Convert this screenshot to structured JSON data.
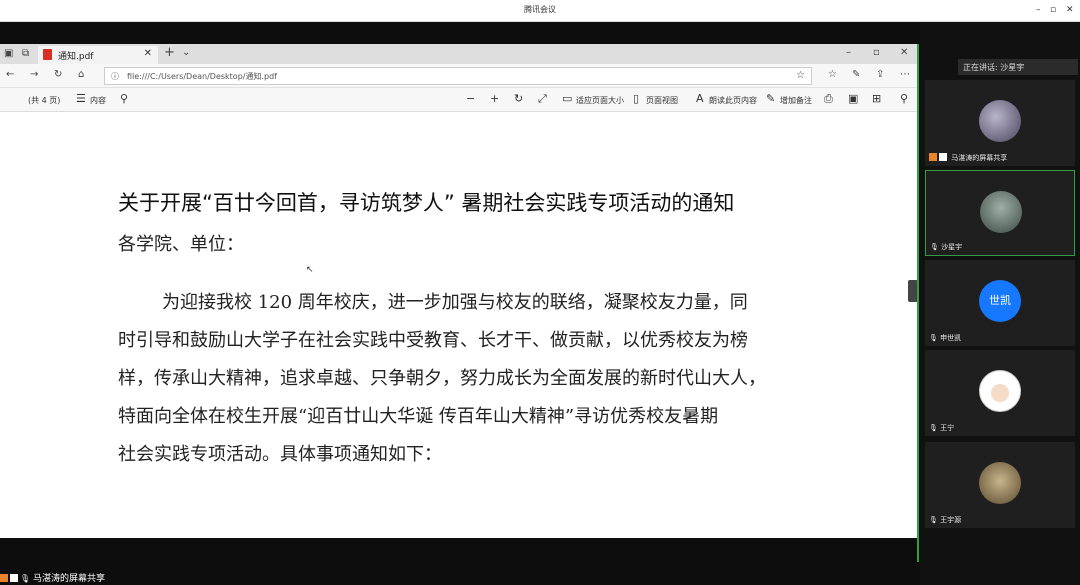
{
  "meeting": {
    "title": "腾讯会议"
  },
  "browser": {
    "tab_title": "通知.pdf",
    "url": "file:///C:/Users/Dean/Desktop/通知.pdf"
  },
  "pdf_toolbar": {
    "page_count": "(共 4 页)",
    "contents": "内容",
    "fit_page": "适应页面大小",
    "page_view": "页面视图",
    "read_aloud": "朗读此页内容",
    "add_note": "增加备注"
  },
  "document": {
    "title": "关于开展“百廿今回首，寻访筑梦人”  暑期社会实践专项活动的通知",
    "salutation": "各学院、单位：",
    "lines": [
      "为迎接我校 120 周年校庆，进一步加强与校友的联络，凝聚校友力量，同",
      "时引导和鼓励山大学子在社会实践中受教育、长才干、做贡献，以优秀校友为榜",
      "样，传承山大精神，追求卓越、只争朝夕，努力成长为全面发展的新时代山大人，",
      "特面向全体在校生开展“迎百廿山大华诞  传百年山大精神”寻访优秀校友暑期",
      "社会实践专项活动。具体事项通知如下："
    ]
  },
  "panel": {
    "speaking": "正在讲话: 沙星宇",
    "participants": [
      {
        "name": "马湛涛的屏幕共享"
      },
      {
        "name": "沙星宇"
      },
      {
        "name": "申世凯",
        "initials": "世凯"
      },
      {
        "name": "王宁"
      },
      {
        "name": "王宇源"
      }
    ]
  },
  "bottom": {
    "share_label": "马湛涛的屏幕共享"
  },
  "colors": {
    "accent_green": "#2ea043",
    "avatar_blue": "#1677ff",
    "pdf_red": "#d93025"
  }
}
